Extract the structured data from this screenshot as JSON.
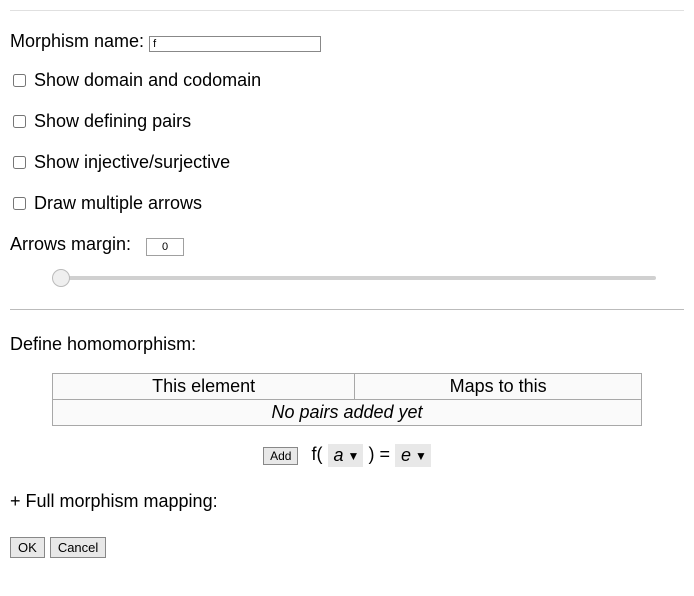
{
  "form": {
    "name_label": "Morphism name:",
    "name_value": "f",
    "options": {
      "show_domain_codomain": {
        "label": "Show domain and codomain",
        "checked": false
      },
      "show_defining_pairs": {
        "label": "Show defining pairs",
        "checked": false
      },
      "show_inj_surj": {
        "label": "Show injective/surjective",
        "checked": false
      },
      "draw_multiple_arrows": {
        "label": "Draw multiple arrows",
        "checked": false
      }
    },
    "arrows_margin": {
      "label": "Arrows margin:",
      "value": "0",
      "min": "0",
      "max": "100"
    }
  },
  "homomorphism": {
    "heading": "Define homomorphism:",
    "table": {
      "col1": "This element",
      "col2": "Maps to this",
      "empty": "No pairs added yet"
    },
    "add": {
      "button": "Add",
      "fn": "f",
      "lp": "(",
      "rp": ")",
      "eq": "=",
      "arg_selected": "a",
      "val_selected": "e"
    }
  },
  "full_mapping": {
    "label": "+ Full morphism mapping:"
  },
  "buttons": {
    "ok": "OK",
    "cancel": "Cancel"
  }
}
